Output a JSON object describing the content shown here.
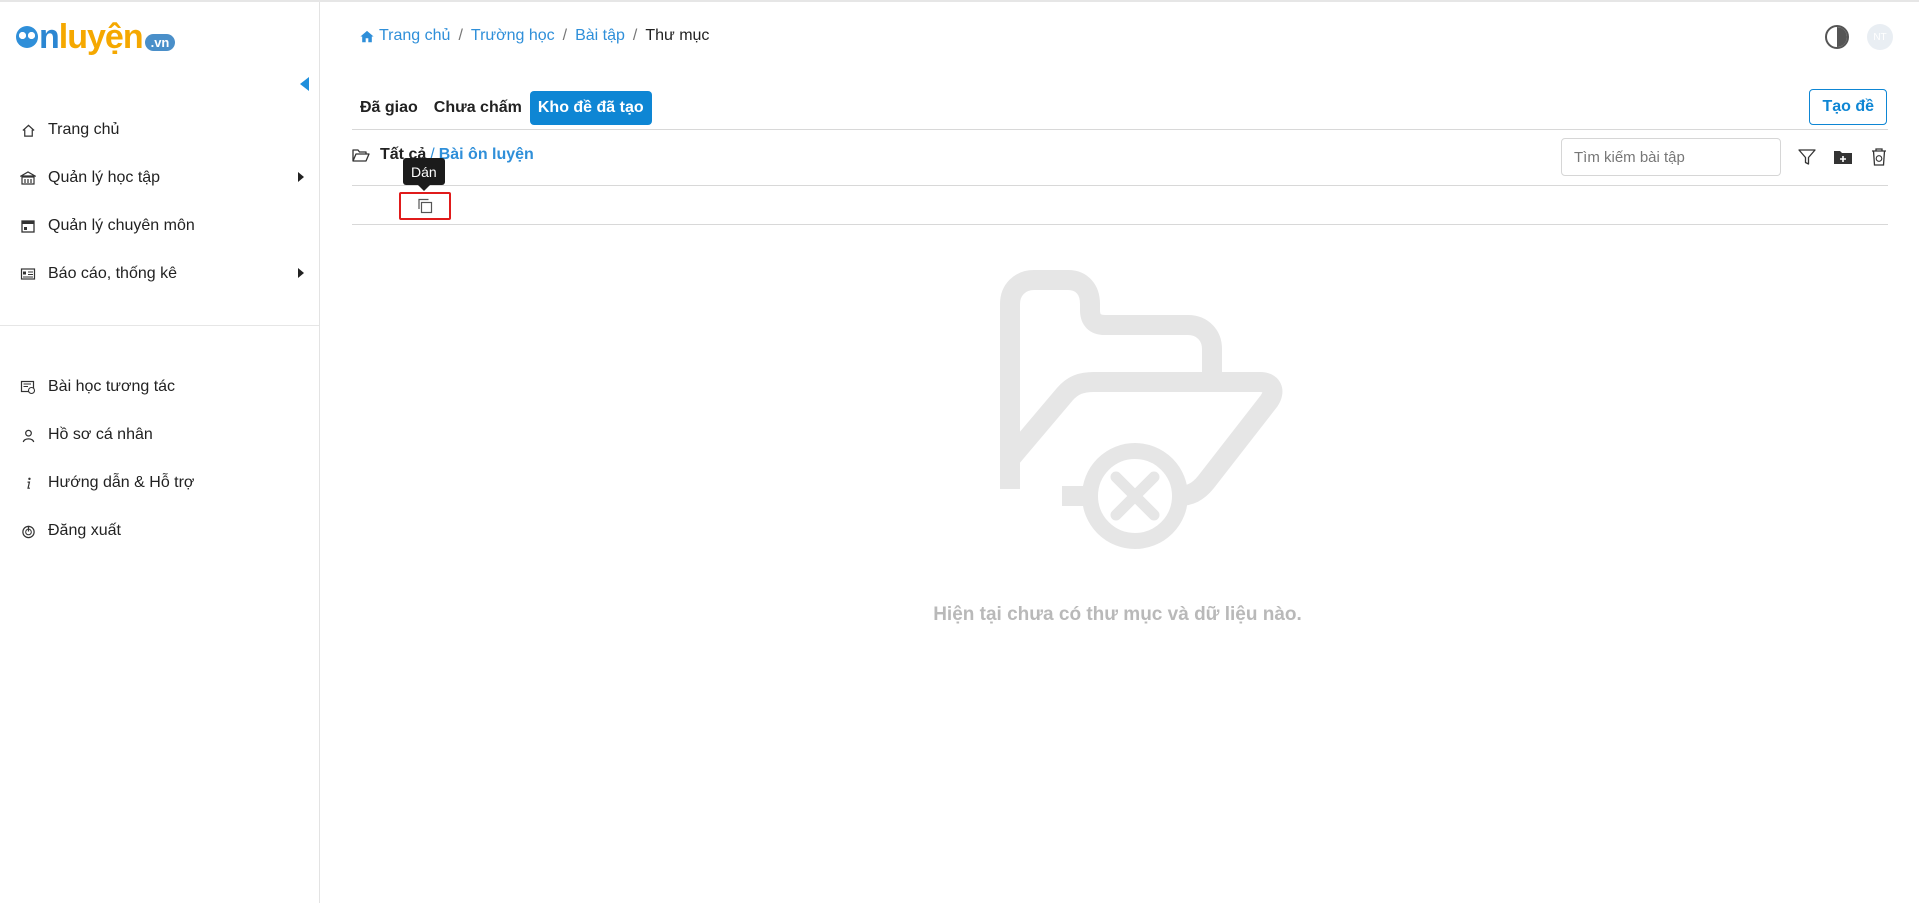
{
  "logo": {
    "part1": "n",
    "part2": "luyện",
    "suffix": ".vn"
  },
  "sidebar": {
    "main_items": [
      {
        "label": "Trang chủ",
        "icon": "home-icon",
        "has_submenu": false
      },
      {
        "label": "Quản lý học tập",
        "icon": "school-icon",
        "has_submenu": true
      },
      {
        "label": "Quản lý chuyên môn",
        "icon": "calendar-icon",
        "has_submenu": false
      },
      {
        "label": "Báo cáo, thống kê",
        "icon": "report-icon",
        "has_submenu": true
      }
    ],
    "secondary_items": [
      {
        "label": "Bài học tương tác",
        "icon": "interactive-lesson-icon"
      },
      {
        "label": "Hồ sơ cá nhân",
        "icon": "user-icon"
      },
      {
        "label": "Hướng dẫn & Hỗ trợ",
        "icon": "info-icon"
      },
      {
        "label": "Đăng xuất",
        "icon": "power-icon"
      }
    ]
  },
  "breadcrumb": {
    "home": "Trang chủ",
    "school": "Trường học",
    "exercises": "Bài tập",
    "current": "Thư mục"
  },
  "header": {
    "avatar_initials": "NT"
  },
  "tabs": [
    {
      "label": "Đã giao",
      "active": false
    },
    {
      "label": "Chưa chấm",
      "active": false
    },
    {
      "label": "Kho đề đã tạo",
      "active": true
    }
  ],
  "create_button": "Tạo đề",
  "path": {
    "root": "Tất cả",
    "separator": "/",
    "current": "Bài ôn luyện"
  },
  "search": {
    "placeholder": "Tìm kiếm bài tập",
    "value": ""
  },
  "paste": {
    "tooltip": "Dán"
  },
  "empty_state": {
    "message": "Hiện tại chưa có thư mục và dữ liệu nào."
  },
  "colors": {
    "primary": "#0e86d4",
    "link": "#2f8fd9",
    "empty_gray": "#e6e6e6",
    "highlight_red": "#e01b1b"
  }
}
